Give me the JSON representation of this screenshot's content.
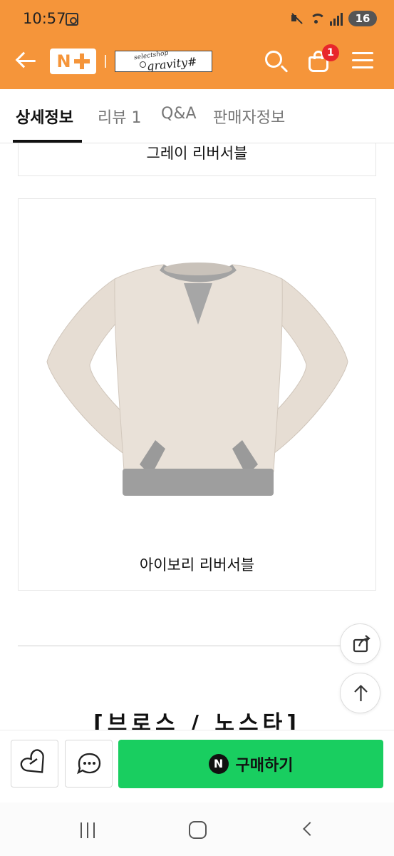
{
  "status_bar": {
    "time": "10:57",
    "battery": "16",
    "icons": [
      "screenshot-icon",
      "mute-icon",
      "wifi-icon",
      "signal-icon",
      "battery-icon"
    ]
  },
  "header": {
    "logo": "N+",
    "store_logo_lines": [
      "selectshop",
      "gravity#"
    ],
    "cart_count": "1",
    "accent_color": "#f5953a",
    "icons": [
      "back-arrow-icon",
      "search-icon",
      "cart-icon",
      "menu-icon"
    ]
  },
  "tabs": [
    {
      "label": "상세정보",
      "active": true
    },
    {
      "label": "리뷰 1",
      "active": false
    },
    {
      "label": "Q&A",
      "active": false
    },
    {
      "label": "판매자정보",
      "active": false
    }
  ],
  "content": {
    "top_card_caption": "그레이 리버서블",
    "main_card_caption": "아이보리 리버서블",
    "section_heading": "[브로스 / 노스타]"
  },
  "floating": {
    "icons": [
      "share-icon",
      "arrow-up-icon"
    ]
  },
  "bottom_bar": {
    "buy_badge": "N",
    "buy_label": "구매하기",
    "buy_color": "#19ce60",
    "icons": [
      "heart-icon",
      "chat-icon"
    ]
  },
  "nav_bar": {
    "icons": [
      "recents-icon",
      "home-icon",
      "back-icon"
    ]
  }
}
